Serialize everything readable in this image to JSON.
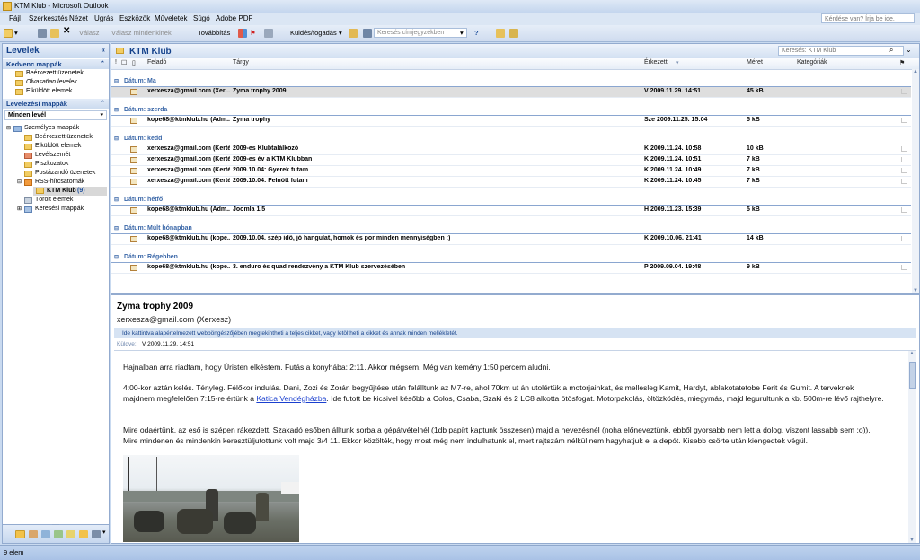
{
  "window": {
    "title": "KTM Klub - Microsoft Outlook"
  },
  "menu": {
    "items": [
      "Fájl",
      "Szerkesztés",
      "Nézet",
      "Ugrás",
      "Eszközök",
      "Műveletek",
      "Súgó",
      "Adobe PDF"
    ],
    "help_placeholder": "Kérdése van? Írja be ide."
  },
  "toolbar": {
    "reply": "Válasz",
    "reply_all": "Válasz mindenkinek",
    "forward": "Továbbítás",
    "send_receive": "Küldés/fogadás",
    "address_search_placeholder": "Keresés címjegyzékben"
  },
  "nav": {
    "title": "Levelek",
    "favorites_title": "Kedvenc mappák",
    "favorites": [
      "Beérkezett üzenetek",
      "Olvasatlan levelek",
      "Elküldött elemek"
    ],
    "mailfolders_title": "Levelezési mappák",
    "all_items": "Minden levél",
    "tree": {
      "personal": "Személyes mappák",
      "inbox": "Beérkezett üzenetek",
      "sent": "Elküldött elemek",
      "junk": "Levélszemét",
      "drafts": "Piszkozatok",
      "outbox": "Postázandó üzenetek",
      "rss": "RSS-hírcsatornák",
      "ktm": "KTM Klub",
      "ktm_count": "(9)",
      "deleted": "Törölt elemek",
      "search": "Keresési mappák"
    }
  },
  "list": {
    "folder_title": "KTM Klub",
    "search_placeholder": "Keresés: KTM Klub",
    "columns": {
      "from": "Feladó",
      "subject": "Tárgy",
      "received": "Érkezett",
      "size": "Méret",
      "categories": "Kategóriák"
    },
    "groups": [
      {
        "label": "Dátum: Ma",
        "rows": [
          {
            "from": "xerxesza@gmail.com (Xer...",
            "subject": "Zyma trophy 2009",
            "received": "V 2009.11.29. 14:51",
            "size": "45 kB",
            "selected": true
          }
        ]
      },
      {
        "label": "Dátum: szerda",
        "rows": [
          {
            "from": "kope68@ktmklub.hu (Adm...",
            "subject": "Zyma trophy",
            "received": "Sze 2009.11.25. 15:04",
            "size": "5 kB"
          }
        ]
      },
      {
        "label": "Dátum: kedd",
        "rows": [
          {
            "from": "xerxesza@gmail.com (Kerté...",
            "subject": "2009-es Klubtalálkozó",
            "received": "K 2009.11.24. 10:58",
            "size": "10 kB"
          },
          {
            "from": "xerxesza@gmail.com (Kerté...",
            "subject": "2009-es év a KTM Klubban",
            "received": "K 2009.11.24. 10:51",
            "size": "7 kB"
          },
          {
            "from": "xerxesza@gmail.com (Kerté...",
            "subject": "2009.10.04: Gyerek futam",
            "received": "K 2009.11.24. 10:49",
            "size": "7 kB"
          },
          {
            "from": "xerxesza@gmail.com (Kerté...",
            "subject": "2009.10.04: Felnőtt futam",
            "received": "K 2009.11.24. 10:45",
            "size": "7 kB"
          }
        ]
      },
      {
        "label": "Dátum: hétfő",
        "rows": [
          {
            "from": "kope68@ktmklub.hu (Adm...",
            "subject": "Joomla 1.5",
            "received": "H 2009.11.23. 15:39",
            "size": "5 kB"
          }
        ]
      },
      {
        "label": "Dátum: Múlt hónapban",
        "rows": [
          {
            "from": "kope68@ktmklub.hu (kope...",
            "subject": "2009.10.04. szép idő, jó hangulat, homok és por minden mennyiségben :)",
            "received": "K 2009.10.06. 21:41",
            "size": "14 kB"
          }
        ]
      },
      {
        "label": "Dátum: Régebben",
        "rows": [
          {
            "from": "kope68@ktmklub.hu (kope...",
            "subject": "3. enduro és quad rendezvény a KTM Klub szervezésében",
            "received": "P 2009.09.04. 19:48",
            "size": "9 kB"
          }
        ]
      }
    ]
  },
  "reading": {
    "subject": "Zyma trophy 2009",
    "sender": "xerxesza@gmail.com (Xerxesz)",
    "infobar": "Ide kattintva alapértelmezett webböngészőjében megtekintheti a teljes cikket, vagy letöltheti a cikket és annak minden mellékletét.",
    "sent_label": "Küldve:",
    "sent_value": "V 2009.11.29. 14:51",
    "p1": "Hajnalban arra riadtam, hogy Úristen elkéstem. Futás a konyhába: 2:11. Akkor mégsem. Még van kemény 1:50 percem aludni.",
    "p2a": "4:00-kor aztán kelés. Tényleg. Félőkor indulás. Dani, Zozi és Zorán begyűjtése után felálltunk az M7-re, ahol 70km ut án utolértük a motorjainkat, és mellesleg Kamit, Hardyt, ablakotatetobe Ferit és Gumit. A terveknek majdnem megfelelően 7:15-re értünk a ",
    "p2link": "Katica Vendégházba",
    "p2b": ". Ide futott be kicsivel később a Colos, Csaba, Szaki és 2 LC8 alkotta ötösfogat. Motorpakolás, öltözködés, miegymás, majd legurultunk a kb. 500m-re lévő rajthelyre.",
    "p3": "Mire odaértünk, az eső is szépen rákezdett. Szakadó esőben álltunk sorba a gépátvételnél (1db papírt kaptunk összesen) majd a nevezésnél (noha előneveztünk, ebből gyorsabb nem lett a dolog, viszont lassabb sem ;o)). Mire mindenen és mindenkin keresztüljutottunk volt majd 3/4 11. Ekkor közölték, hogy most még nem indulhatunk el, mert rajtszám nélkül nem hagyhatjuk el a depót. Kisebb csörte után kiengedtek végül."
  },
  "status": {
    "items": "9 elem"
  }
}
